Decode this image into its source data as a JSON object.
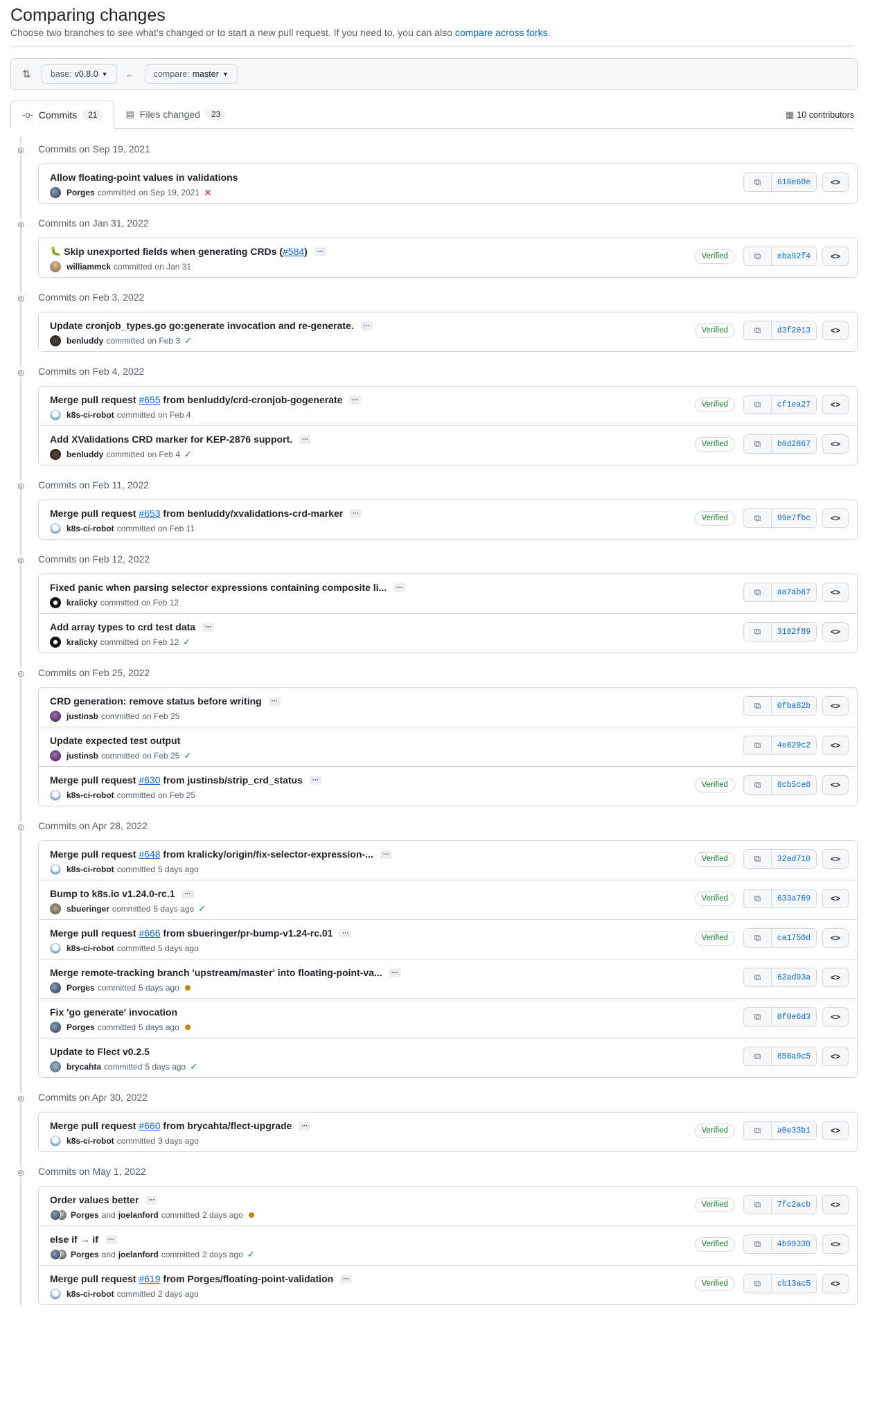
{
  "header": {
    "title": "Comparing changes",
    "subtitle": "Choose two branches to see what’s changed or to start a new pull request. If you need to, you can also",
    "compare_link": "compare across forks."
  },
  "range": {
    "base_label": "base:",
    "base_value": "v0.8.0",
    "compare_label": "compare:",
    "compare_value": "master"
  },
  "tabs": {
    "commits_label": "Commits",
    "commits_count": "21",
    "files_label": "Files changed",
    "files_count": "23",
    "contributors": "10 contributors"
  },
  "labels": {
    "committed": "committed",
    "and": "and",
    "verified": "Verified",
    "ellipsis": "···"
  },
  "groups": [
    {
      "date": "Commits on Sep 19, 2021",
      "commits": [
        {
          "parts": [
            {
              "t": "Allow floating-point values in validations"
            }
          ],
          "more": false,
          "author": "Porges",
          "avatar": "av-porges",
          "when": "on Sep 19, 2021",
          "status": "x",
          "verified": false,
          "sha": "618e68e",
          "emoji": ""
        }
      ]
    },
    {
      "date": "Commits on Jan 31, 2022",
      "commits": [
        {
          "parts": [
            {
              "t": "Skip unexported fields when generating CRDs ("
            },
            {
              "t": "#584",
              "link": true
            },
            {
              "t": ")"
            }
          ],
          "more": true,
          "author": "williammck",
          "avatar": "av-william",
          "when": "on Jan 31",
          "status": "",
          "verified": true,
          "sha": "eba92f4",
          "emoji": "🐛"
        }
      ]
    },
    {
      "date": "Commits on Feb 3, 2022",
      "commits": [
        {
          "parts": [
            {
              "t": "Update cronjob_types.go go:generate invocation and re-generate."
            }
          ],
          "more": true,
          "author": "benluddy",
          "avatar": "av-benluddy",
          "when": "on Feb 3",
          "status": "check",
          "verified": true,
          "sha": "d3f2013",
          "emoji": ""
        }
      ]
    },
    {
      "date": "Commits on Feb 4, 2022",
      "commits": [
        {
          "parts": [
            {
              "t": "Merge pull request "
            },
            {
              "t": "#655",
              "link": true
            },
            {
              "t": " from benluddy/crd-cronjob-gogenerate"
            }
          ],
          "more": true,
          "author": "k8s-ci-robot",
          "avatar": "av-bot",
          "when": "on Feb 4",
          "status": "",
          "verified": true,
          "sha": "cf1ea27",
          "emoji": ""
        },
        {
          "parts": [
            {
              "t": "Add XValidations CRD marker for KEP-2876 support."
            }
          ],
          "more": true,
          "author": "benluddy",
          "avatar": "av-benluddy",
          "when": "on Feb 4",
          "status": "check",
          "verified": true,
          "sha": "b0d2867",
          "emoji": ""
        }
      ]
    },
    {
      "date": "Commits on Feb 11, 2022",
      "commits": [
        {
          "parts": [
            {
              "t": "Merge pull request "
            },
            {
              "t": "#653",
              "link": true
            },
            {
              "t": " from benluddy/xvalidations-crd-marker"
            }
          ],
          "more": true,
          "author": "k8s-ci-robot",
          "avatar": "av-bot",
          "when": "on Feb 11",
          "status": "",
          "verified": true,
          "sha": "99e7fbc",
          "emoji": ""
        }
      ]
    },
    {
      "date": "Commits on Feb 12, 2022",
      "commits": [
        {
          "parts": [
            {
              "t": "Fixed panic when parsing selector expressions containing composite li..."
            }
          ],
          "more": true,
          "author": "kralicky",
          "avatar": "av-kralicky",
          "when": "on Feb 12",
          "status": "",
          "verified": false,
          "sha": "aa7ab67",
          "emoji": ""
        },
        {
          "parts": [
            {
              "t": "Add array types to crd test data"
            }
          ],
          "more": true,
          "author": "kralicky",
          "avatar": "av-kralicky",
          "when": "on Feb 12",
          "status": "check",
          "verified": false,
          "sha": "3102f89",
          "emoji": ""
        }
      ]
    },
    {
      "date": "Commits on Feb 25, 2022",
      "commits": [
        {
          "parts": [
            {
              "t": "CRD generation: remove status before writing"
            }
          ],
          "more": true,
          "author": "justinsb",
          "avatar": "av-justinsb",
          "when": "on Feb 25",
          "status": "",
          "verified": false,
          "sha": "0fba82b",
          "emoji": ""
        },
        {
          "parts": [
            {
              "t": "Update expected test output"
            }
          ],
          "more": false,
          "author": "justinsb",
          "avatar": "av-justinsb",
          "when": "on Feb 25",
          "status": "check",
          "verified": false,
          "sha": "4e829c2",
          "emoji": ""
        },
        {
          "parts": [
            {
              "t": "Merge pull request "
            },
            {
              "t": "#630",
              "link": true
            },
            {
              "t": " from justinsb/strip_crd_status"
            }
          ],
          "more": true,
          "author": "k8s-ci-robot",
          "avatar": "av-bot",
          "when": "on Feb 25",
          "status": "",
          "verified": true,
          "sha": "8cb5ce8",
          "emoji": ""
        }
      ]
    },
    {
      "date": "Commits on Apr 28, 2022",
      "commits": [
        {
          "parts": [
            {
              "t": "Merge pull request "
            },
            {
              "t": "#648",
              "link": true
            },
            {
              "t": " from kralicky/origin/fix-selector-expression-..."
            }
          ],
          "more": true,
          "author": "k8s-ci-robot",
          "avatar": "av-bot",
          "when": "5 days ago",
          "status": "",
          "verified": true,
          "sha": "32ad710",
          "emoji": ""
        },
        {
          "parts": [
            {
              "t": "Bump to k8s.io v1.24.0-rc.1"
            }
          ],
          "more": true,
          "author": "sbueringer",
          "avatar": "av-sbueringer",
          "when": "5 days ago",
          "status": "check",
          "verified": true,
          "sha": "633a769",
          "emoji": ""
        },
        {
          "parts": [
            {
              "t": "Merge pull request "
            },
            {
              "t": "#666",
              "link": true
            },
            {
              "t": " from sbueringer/pr-bump-v1.24-rc.01"
            }
          ],
          "more": true,
          "author": "k8s-ci-robot",
          "avatar": "av-bot",
          "when": "5 days ago",
          "status": "",
          "verified": true,
          "sha": "ca1750d",
          "emoji": ""
        },
        {
          "parts": [
            {
              "t": "Merge remote-tracking branch 'upstream/master' into floating-point-va..."
            }
          ],
          "more": true,
          "author": "Porges",
          "avatar": "av-porges",
          "when": "5 days ago",
          "status": "dot",
          "verified": false,
          "sha": "62ad93a",
          "emoji": ""
        },
        {
          "parts": [
            {
              "t": "Fix 'go generate' invocation"
            }
          ],
          "more": false,
          "author": "Porges",
          "avatar": "av-porges",
          "when": "5 days ago",
          "status": "dot",
          "verified": false,
          "sha": "8f0e6d3",
          "emoji": ""
        },
        {
          "parts": [
            {
              "t": "Update to Flect v0.2.5"
            }
          ],
          "more": false,
          "author": "brycahta",
          "avatar": "av-brycahta",
          "when": "5 days ago",
          "status": "check",
          "verified": false,
          "sha": "856a9c5",
          "emoji": ""
        }
      ]
    },
    {
      "date": "Commits on Apr 30, 2022",
      "commits": [
        {
          "parts": [
            {
              "t": "Merge pull request "
            },
            {
              "t": "#660",
              "link": true
            },
            {
              "t": " from brycahta/flect-upgrade"
            }
          ],
          "more": true,
          "author": "k8s-ci-robot",
          "avatar": "av-bot",
          "when": "3 days ago",
          "status": "",
          "verified": true,
          "sha": "a0e33b1",
          "emoji": ""
        }
      ]
    },
    {
      "date": "Commits on May 1, 2022",
      "commits": [
        {
          "parts": [
            {
              "t": "Order values better"
            }
          ],
          "more": true,
          "author": "Porges",
          "coauthor": "joelanford",
          "avatar": "pair",
          "when": "2 days ago",
          "status": "dot",
          "verified": true,
          "sha": "7fc2acb",
          "emoji": ""
        },
        {
          "parts": [
            {
              "t": "else if → if"
            }
          ],
          "more": true,
          "author": "Porges",
          "coauthor": "joelanford",
          "avatar": "pair",
          "when": "2 days ago",
          "status": "check",
          "verified": true,
          "sha": "4b99330",
          "emoji": ""
        },
        {
          "parts": [
            {
              "t": "Merge pull request "
            },
            {
              "t": "#619",
              "link": true
            },
            {
              "t": " from Porges/floating-point-validation"
            }
          ],
          "more": true,
          "author": "k8s-ci-robot",
          "avatar": "av-bot",
          "when": "2 days ago",
          "status": "",
          "verified": true,
          "sha": "cb13ac5",
          "emoji": ""
        }
      ]
    }
  ]
}
